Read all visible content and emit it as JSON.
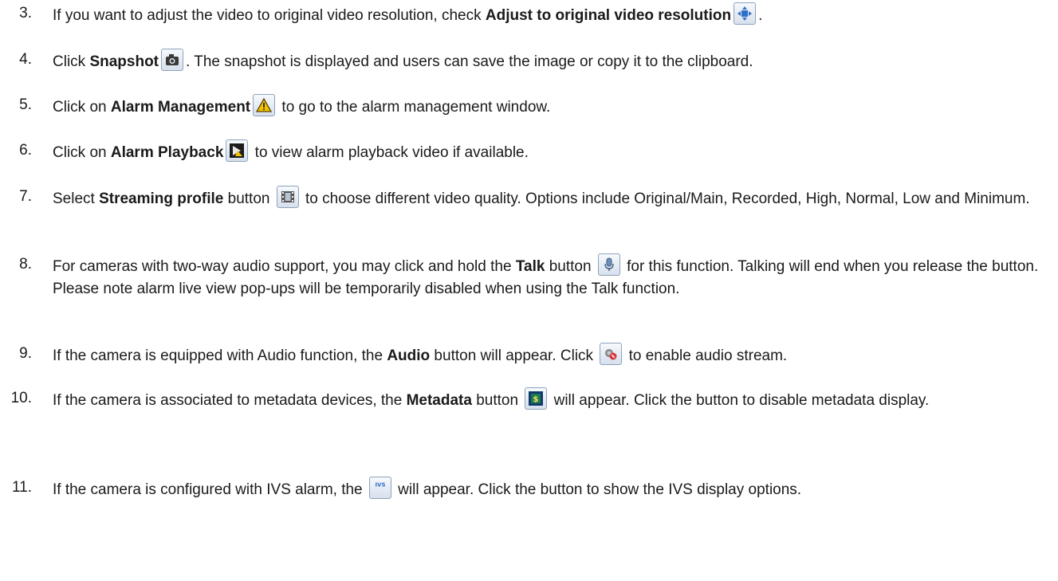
{
  "items": [
    {
      "num": "3.",
      "parts": [
        "If you want to adjust the video to original video resolution, check ",
        "Adjust to original video resolution",
        "."
      ],
      "icon": "adjust-resolution-icon"
    },
    {
      "num": "4.",
      "parts": [
        "Click ",
        "Snapshot",
        ". The snapshot is displayed and users can save the image or copy it to the clipboard."
      ],
      "icon": "camera-icon"
    },
    {
      "num": "5.",
      "parts": [
        "Click on ",
        "Alarm Management",
        " to go to the alarm management window."
      ],
      "icon": "warning-icon"
    },
    {
      "num": "6.",
      "parts": [
        "Click on ",
        "Alarm Playback",
        " to view alarm playback video if available."
      ],
      "icon": "alarm-playback-icon"
    },
    {
      "num": "7.",
      "parts": [
        "Select ",
        "Streaming profile",
        " button ",
        " to choose different video quality.  Options include Original/Main, Recorded, High, Normal, Low and Minimum."
      ],
      "icon": "film-icon"
    },
    {
      "num": "8.",
      "parts": [
        "For cameras with two-way audio support, you may click and hold the ",
        "Talk",
        " button ",
        " for this function.  Talking will end when you release the button.  Please note alarm live view pop-ups will be temporarily disabled when using the Talk function."
      ],
      "icon": "microphone-icon"
    },
    {
      "num": "9.",
      "parts": [
        "If the camera is equipped with Audio function, the ",
        "Audio",
        " button will appear. Click ",
        " to enable audio stream."
      ],
      "icon": "audio-icon"
    },
    {
      "num": "10.",
      "parts": [
        "If the camera is associated to metadata devices, the ",
        "Metadata",
        " button ",
        " will appear. Click the button to disable metadata display."
      ],
      "icon": "metadata-icon"
    },
    {
      "num": "11.",
      "parts": [
        "If the camera is configured with IVS alarm, the ",
        " will appear. Click the button to show the IVS display options."
      ],
      "icon": "ivs-icon",
      "icon_text": "IVS"
    }
  ],
  "colors": {
    "text": "#1a1a1a",
    "icon_border": "#8ea2bb",
    "warning": "#f2c200",
    "metadata": "#1f7a52"
  }
}
